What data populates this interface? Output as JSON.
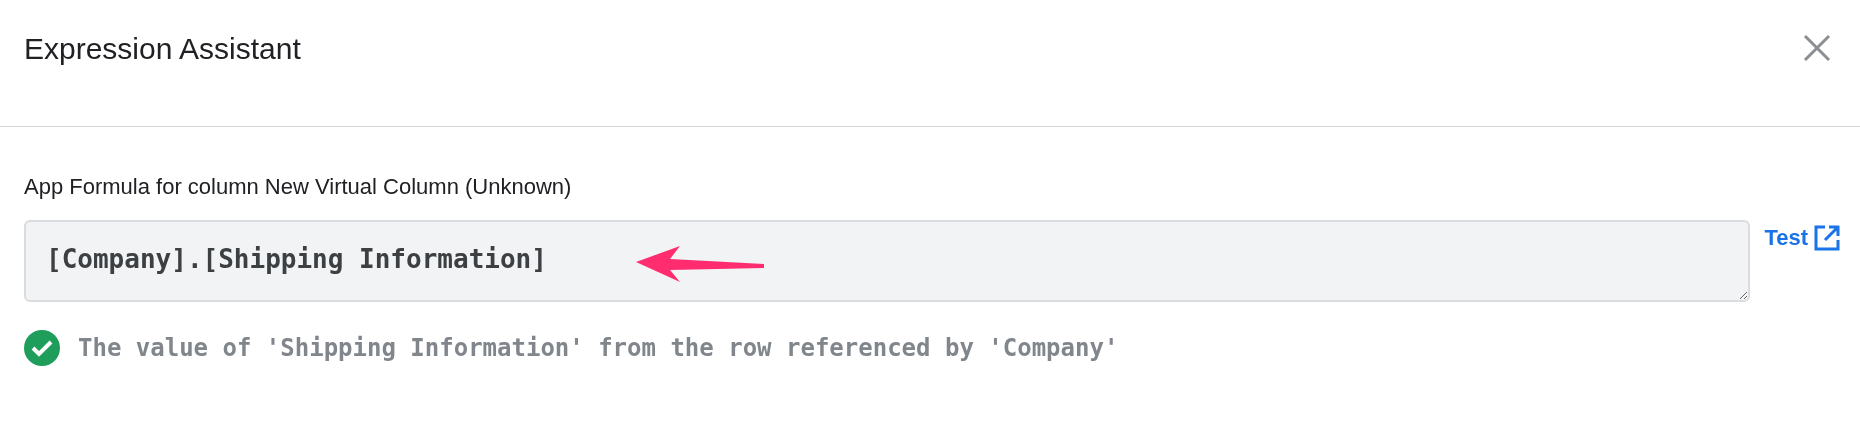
{
  "dialog": {
    "title": "Expression Assistant"
  },
  "formula": {
    "label": "App Formula for column New Virtual Column (Unknown)",
    "value": "[Company].[Shipping Information]",
    "test_link": "Test"
  },
  "result": {
    "valid": true,
    "message": "The value of 'Shipping Information' from the row referenced by 'Company'"
  }
}
